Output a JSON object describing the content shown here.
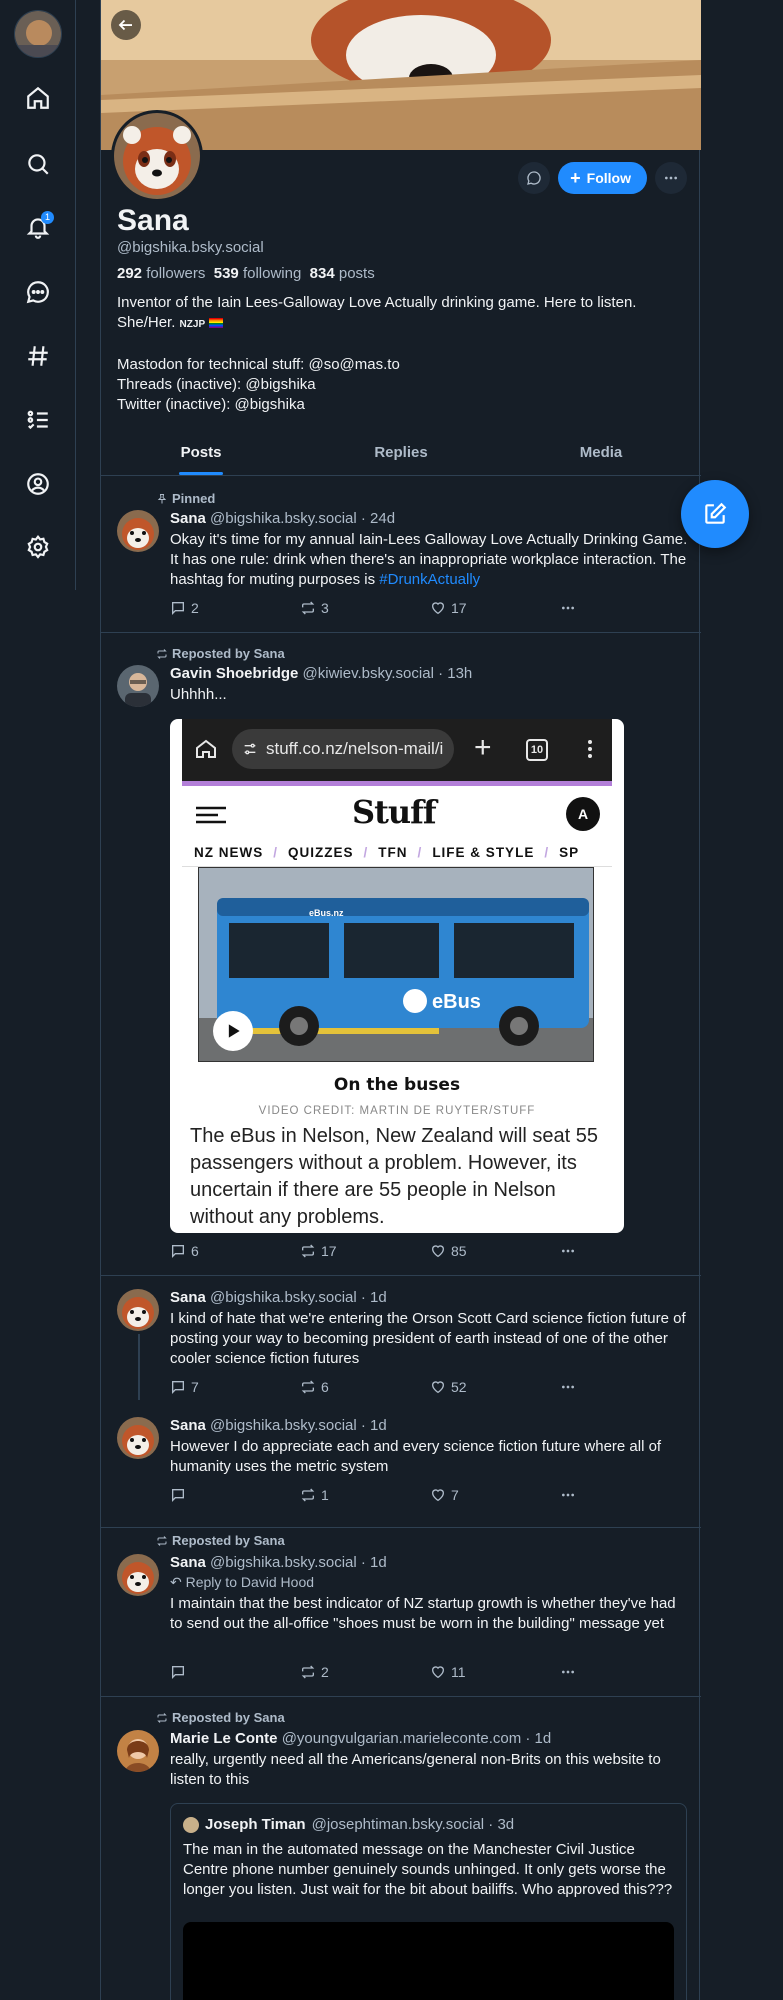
{
  "nav": {
    "notification_count": "1"
  },
  "profile": {
    "display_name": "Sana",
    "handle": "@bigshika.bsky.social",
    "followers_count": "292",
    "followers_label": "followers",
    "following_count": "539",
    "following_label": "following",
    "posts_count": "834",
    "posts_label": "posts",
    "follow_label": "Follow",
    "bio": {
      "line1": "Inventor of the Iain Lees-Galloway Love Actually drinking game. Here to listen.",
      "line2": "She/Her.",
      "line2_tag": "NZJP",
      "line4": "Mastodon for technical stuff: @so@mas.to",
      "line5": "Threads (inactive): @bigshika",
      "line6": "Twitter (inactive): @bigshika"
    }
  },
  "tabs": [
    "Posts",
    "Replies",
    "Media"
  ],
  "posts": [
    {
      "context": "Pinned",
      "author": "Sana",
      "meta": "@bigshika.bsky.social · 24d",
      "text": "Okay it's time for my annual Iain-Lees Galloway Love Actually Drinking Game. It has one rule: drink when there's an inappropriate workplace interaction. The hashtag for muting purposes is ",
      "hashtag": "#DrunkActually",
      "replies": "2",
      "reposts": "3",
      "likes": "17"
    },
    {
      "context": "Reposted by Sana",
      "author": "Gavin Shoebridge",
      "meta": "@kiwiev.bsky.social · 13h",
      "text": "Uhhhh...",
      "replies": "6",
      "reposts": "17",
      "likes": "85",
      "image": {
        "url": "stuff.co.nz/nelson-mail/i",
        "tab_count": "10",
        "logo": "Stuff",
        "account_initial": "A",
        "nav": [
          "NZ NEWS",
          "QUIZZES",
          "TFN",
          "LIFE & STYLE",
          "SP"
        ],
        "caption": "On the buses",
        "credit": "VIDEO CREDIT: MARTIN DE RUYTER/STUFF",
        "body": "The eBus in Nelson, New Zealand will seat 55 passengers without a problem. However, its uncertain if there are 55 people in Nelson without any problems.",
        "bus_brand": "eBus",
        "bus_url": "eBus.nz"
      }
    },
    {
      "author": "Sana",
      "meta": "@bigshika.bsky.social · 1d",
      "text": "I kind of hate that we're entering the Orson Scott Card science fiction future of posting your way to becoming president of earth instead of one of the other cooler science fiction futures",
      "replies": "7",
      "reposts": "6",
      "likes": "52"
    },
    {
      "author": "Sana",
      "meta": "@bigshika.bsky.social · 1d",
      "text": "However I do appreciate each and every science fiction future where all of humanity uses the metric system",
      "replies": "",
      "reposts": "1",
      "likes": "7"
    },
    {
      "context": "Reposted by Sana",
      "author": "Sana",
      "meta": "@bigshika.bsky.social · 1d",
      "reply_to": "Reply to David Hood",
      "text": "I maintain that the best indicator of NZ startup growth is whether they've had to send out the all-office \"shoes must be worn in the building\" message yet",
      "replies": "",
      "reposts": "2",
      "likes": "11"
    },
    {
      "context": "Reposted by Sana",
      "author": "Marie Le Conte",
      "meta": "@youngvulgarian.marieleconte.com · 1d",
      "text": "really, urgently need all the Americans/general non-Brits on this website to listen to this",
      "quote": {
        "author": "Joseph Timan",
        "meta": "@josephtiman.bsky.social · 3d",
        "text": "The man in the automated message on the Manchester Civil Justice Centre phone number genuinely sounds unhinged. It only gets worse the longer you listen. Just wait for the bit about bailiffs. Who approved this???"
      }
    }
  ],
  "colors": {
    "background": "#161e27",
    "accent": "#208bfe",
    "border": "#2e4052",
    "muted_text": "#aebbc9"
  }
}
